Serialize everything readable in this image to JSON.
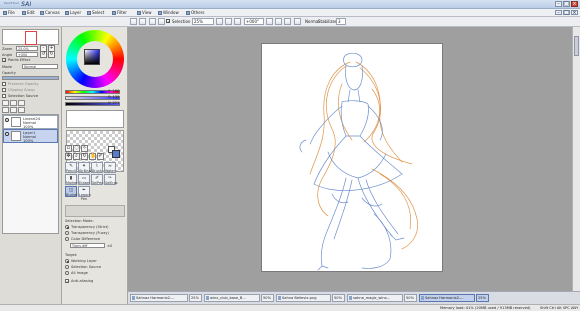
{
  "app": {
    "logo": "SAI",
    "logo_sub": "PaintTool"
  },
  "menu": [
    "File",
    "Edit",
    "Canvas",
    "Layer",
    "Select",
    "Filter",
    "View",
    "Window",
    "Others"
  ],
  "toolbar": {
    "selection_label": "Selection",
    "zoom_value": "25%",
    "rotation_value": "+000°",
    "blend_label": "Normal",
    "stabilizer_label": "Stabilizer",
    "stabilizer_value": "3"
  },
  "navigator": {
    "zoom_label": "Zoom",
    "zoom_value": "25.0%",
    "angle_label": "Angle",
    "angle_value": "+000",
    "flip_label": "Paints Effect"
  },
  "layer_props": {
    "mode_label": "Mode",
    "mode_value": "Normal",
    "opacity_label": "Opacity",
    "opacity_value": "100%",
    "preserve_opacity": "Preserve Opacity",
    "clipping_group": "Clipping Group",
    "selection_source": "Selection Source"
  },
  "layers": [
    {
      "name": "Lineart24",
      "mode": "Normal",
      "opacity": "100%",
      "selected": false
    },
    {
      "name": "Layer1",
      "mode": "Normal",
      "opacity": "100%",
      "selected": true
    }
  ],
  "color_values": {
    "h": "0: 160",
    "s": "S: 135",
    "v": "V: 221"
  },
  "tools_row1": [
    {
      "label": "Pencil",
      "glyph": "✎"
    },
    {
      "label": "AirBrush",
      "glyph": "✦"
    },
    {
      "label": "Brush",
      "glyph": "⌇"
    },
    {
      "label": "Water",
      "glyph": "≈"
    }
  ],
  "tools_row2": [
    {
      "label": "Marker",
      "glyph": "▮"
    },
    {
      "label": "Eraser",
      "glyph": "▭"
    },
    {
      "label": "SelPen",
      "glyph": "✐"
    },
    {
      "label": "SelEras",
      "glyph": "✑"
    }
  ],
  "tools_row3": [
    {
      "label": "Bucket",
      "glyph": "◫",
      "active": true
    },
    {
      "label": "Legacy Pen",
      "glyph": "✒",
      "active": false
    }
  ],
  "bucket_options": {
    "detection_label": "Selection Mode:",
    "options": [
      "Transparency (Strict)",
      "Transparency (Fuzzy)",
      "Color Difference"
    ],
    "selected_index": 0,
    "trans_diff_value": "Trans diff",
    "trans_diff_num": "±0",
    "target_label": "Target:",
    "targets": [
      "Working Layer",
      "Selection Source",
      "All Image"
    ],
    "target_selected": 0,
    "antialias_label": "Anti-aliasing"
  },
  "tasks": [
    {
      "label": "Sahnaz Harmonix2....",
      "pct": "25%"
    },
    {
      "label": "winx_club_base_B...",
      "pct": "50%"
    },
    {
      "label": "Sahna Believix.png",
      "pct": "50%"
    },
    {
      "label": "sahna_magic_winx...",
      "pct": "50%"
    },
    {
      "label": "Sahnaz Harmonix2....",
      "pct": "25%",
      "active": true
    }
  ],
  "status": {
    "memory": "Memory load: 41% (20MB used / 913MB reserved)",
    "keys": "Shift Ctrl Alt SPC ANY"
  },
  "colors": {
    "accent": "#5775aa",
    "lineart_blue": "#6f8fcf",
    "lineart_orange": "#e0954a",
    "canvas_bg": "#9f9f9f"
  }
}
